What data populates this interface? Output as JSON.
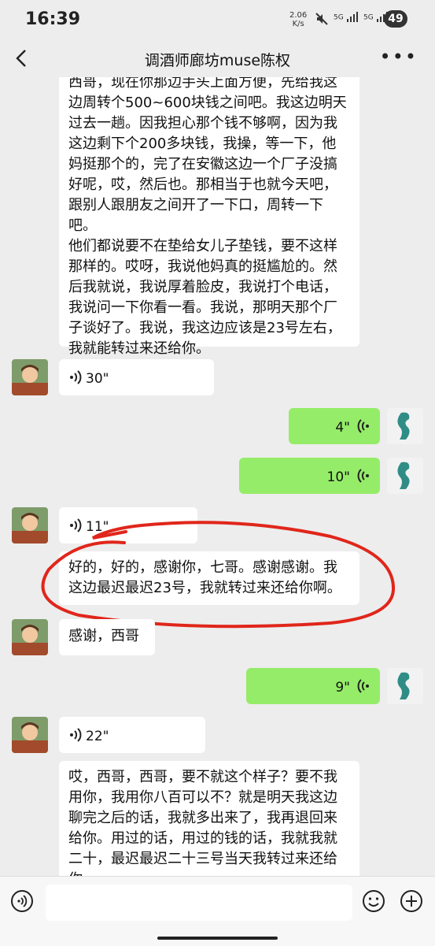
{
  "status_bar": {
    "time": "16:39",
    "speed_value": "2.06",
    "speed_unit": "K/s",
    "network1": "5G",
    "network2": "5G",
    "battery": "49"
  },
  "header": {
    "title": "调酒师廊坊muse陈权"
  },
  "messages": {
    "m1_lines": [
      "西哥，现在你那边手头上面方便，先给我这",
      "边周转个500~600块钱之间吧。我这边明天",
      "过去一趟。因我担心那个钱不够啊，因为我",
      "这边剩下个200多块钱，我操，等一下，他",
      "妈挺那个的，完了在安徽这边一个厂子没搞",
      "好呢，哎，然后也。那相当于也就今天吧，",
      "跟别人跟朋友之间开了一下口，周转一下吧。",
      "他们都说要不在垫给女儿子垫钱，要不这样",
      "那样的。哎呀，我说他妈真的挺尴尬的。然",
      "后我就说，我说厚着脸皮，我说打个电话，",
      "我说问一下你看一看。我说，那明天那个厂",
      "子谈好了。我说，我这边应该是23号左右，",
      "我就能转过来还给你。"
    ],
    "v1": "30\"",
    "v2": "4\"",
    "v3": "10\"",
    "v4": "11\"",
    "m2_lines": [
      "好的，好的，感谢你，七哥。感谢感谢。我",
      "这边最迟最迟23号，我就转过来还给你啊。"
    ],
    "m3": "感谢，西哥",
    "v5": "9\"",
    "v6": "22\"",
    "m4_lines": [
      "哎，西哥，西哥，要不就这个样子？要不我",
      "用你，我用你八百可以不？就是明天我这边",
      "聊完之后的话，我就多出来了，我再退回来",
      "给你。用过的话，用过的钱的话，我就我就",
      "二十，最迟最迟二十三号当天我转过来还给",
      "你。"
    ]
  },
  "colors": {
    "sent_bubble": "#95ec69",
    "received_bubble": "#ffffff",
    "annotation_stroke": "#e0261b"
  }
}
